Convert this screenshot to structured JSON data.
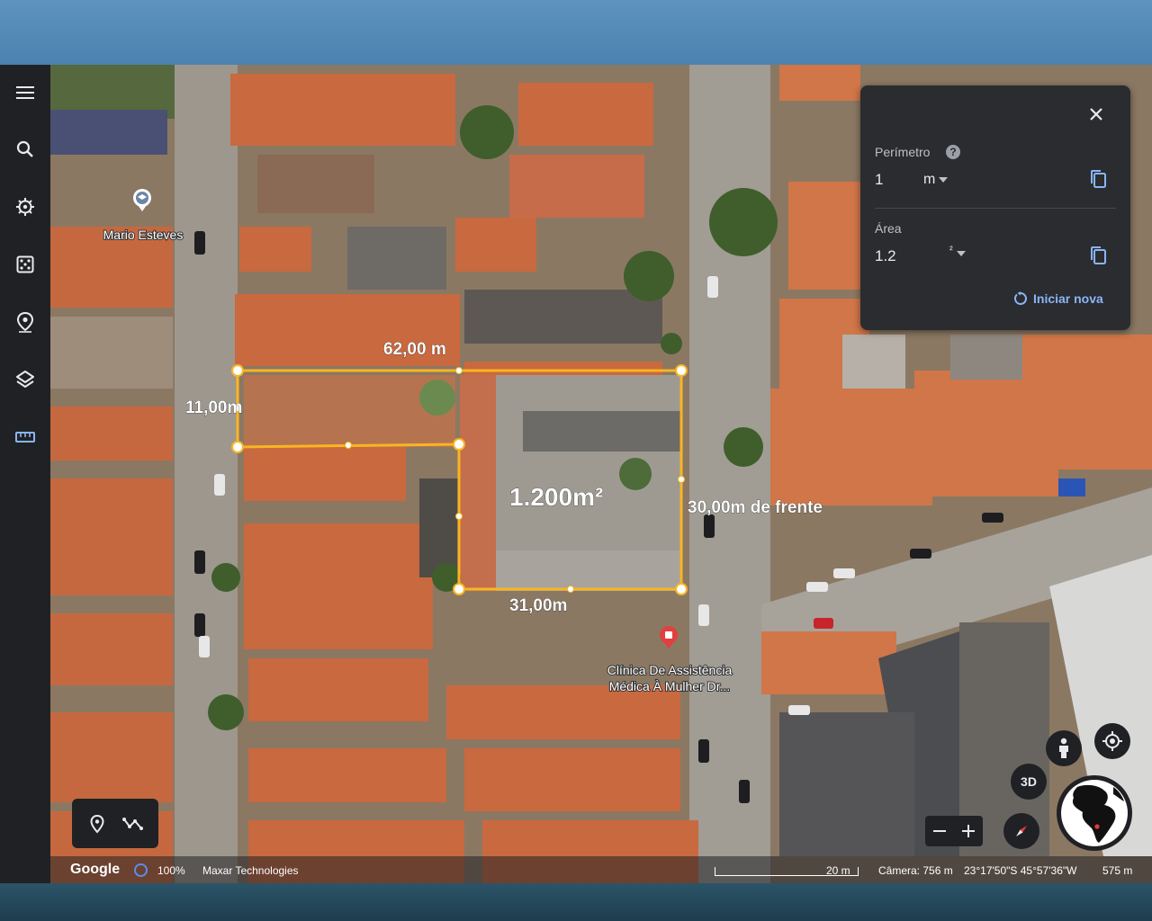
{
  "sidebar": {
    "items": [
      "menu-icon",
      "search-icon",
      "voyager-icon",
      "dice-icon",
      "projects-icon",
      "layers-icon",
      "ruler-icon"
    ]
  },
  "map": {
    "places": {
      "mario": "Mario Esteves",
      "clinic_line1": "Clínica De Assistência",
      "clinic_line2": "Médica À Mulher Dr..."
    },
    "measurements": {
      "top": "62,00 m",
      "left": "11,00m",
      "right": "30,00m de frente",
      "bottom": "31,00m",
      "area": "1.200m²"
    },
    "colors": {
      "polygon": "#f9b522",
      "panel": "#2b2c2f",
      "accent": "#8ab4f8"
    }
  },
  "panel": {
    "perimeter_label": "Perímetro",
    "perimeter_value": "1",
    "perimeter_unit": "m",
    "area_label": "Área",
    "area_value": "1.2",
    "area_unit": "²",
    "restart_label": "Iniciar nova"
  },
  "controls": {
    "three_d": "3D"
  },
  "status": {
    "brand": "Google",
    "loading": "100%",
    "provider": "Maxar Technologies",
    "scale": "20 m",
    "camera": "Câmera: 756 m",
    "coords": "23°17'50\"S 45°57'36\"W",
    "altitude": "575 m"
  }
}
